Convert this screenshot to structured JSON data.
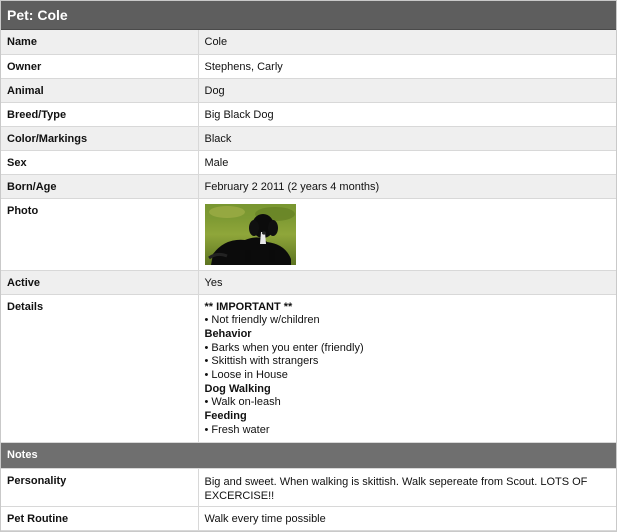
{
  "title": "Pet: Cole",
  "rows": [
    {
      "label": "Name",
      "value": "Cole"
    },
    {
      "label": "Owner",
      "value": "Stephens, Carly"
    },
    {
      "label": "Animal",
      "value": "Dog"
    },
    {
      "label": "Breed/Type",
      "value": "Big Black Dog"
    },
    {
      "label": "Color/Markings",
      "value": "Black"
    },
    {
      "label": "Sex",
      "value": "Male"
    },
    {
      "label": "Born/Age",
      "value": "February 2 2011 (2 years 4 months)"
    },
    {
      "label": "Photo"
    },
    {
      "label": "Active",
      "value": "Yes"
    },
    {
      "label": "Details"
    }
  ],
  "details": {
    "important": "** IMPORTANT **",
    "lines": [
      "• Not friendly w/children"
    ],
    "behavior_heading": "Behavior",
    "behavior": [
      "• Barks when you enter (friendly)",
      "• Skittish with strangers",
      "• Loose in House"
    ],
    "walking_heading": "Dog Walking",
    "walking": [
      "• Walk on-leash"
    ],
    "feeding_heading": "Feeding",
    "feeding": [
      "• Fresh water"
    ]
  },
  "notes": {
    "header": "Notes",
    "rows": [
      {
        "label": "Personality",
        "value": "Big and sweet. When walking is skittish. Walk sepereate from Scout. LOTS OF EXCERCISE!!"
      },
      {
        "label": "Pet Routine",
        "value": "Walk every time possible"
      }
    ]
  }
}
